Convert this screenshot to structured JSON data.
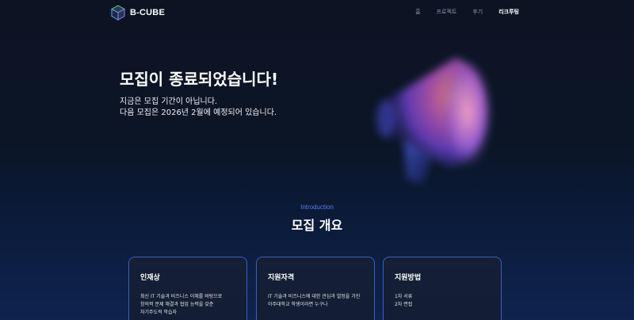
{
  "header": {
    "logo_text": "B-CUBE",
    "nav": [
      {
        "label": "홈",
        "active": false
      },
      {
        "label": "프로젝트",
        "active": false
      },
      {
        "label": "후기",
        "active": false
      },
      {
        "label": "리크루팅",
        "active": true
      }
    ]
  },
  "hero": {
    "title": "모집이 종료되었습니다!",
    "subtitle_lines": [
      "지금은 모집 기간이 아닙니다.",
      "다음 모집은 2026년 2월에 예정되어 있습니다."
    ],
    "illustration_icon": "megaphone-icon"
  },
  "intro": {
    "label": "Introduction",
    "title": "모집 개요"
  },
  "cards": [
    {
      "title": "인재상",
      "lines": [
        "최신 IT 기술과 비즈니스 이해를 바탕으로",
        "창의적 문제 해결과 협업 능력을 갖춘",
        "자기주도적 학습자"
      ]
    },
    {
      "title": "지원자격",
      "lines": [
        "IT 기술과 비즈니스에 대한 관심과 열정을 가진",
        "아주대학교 학생이라면 누구나"
      ]
    },
    {
      "title": "지원방법",
      "lines": [
        "1차 서류",
        "2차 면접"
      ]
    }
  ],
  "colors": {
    "accent": "#5b7fe0",
    "card_border": "#3b5fbf",
    "background": "#0c1424"
  }
}
